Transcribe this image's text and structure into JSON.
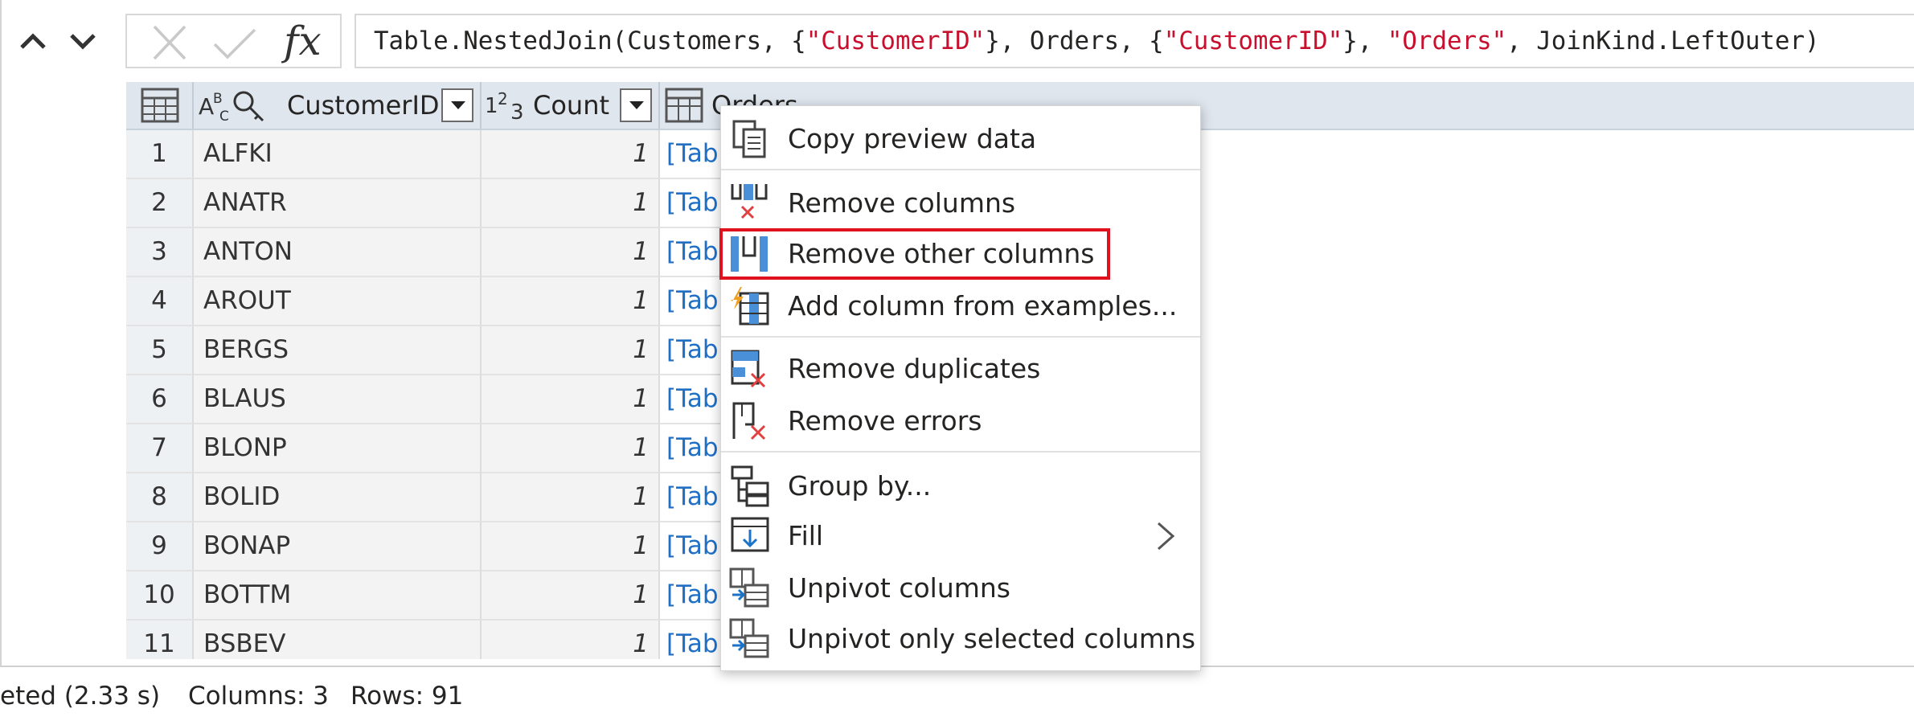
{
  "formula_bar": {
    "fx_label": "fx",
    "formula_parts": [
      {
        "text": "Table.NestedJoin(Customers, {",
        "kind": "plain"
      },
      {
        "text": "\"CustomerID\"",
        "kind": "string"
      },
      {
        "text": "}, Orders, {",
        "kind": "plain"
      },
      {
        "text": "\"CustomerID\"",
        "kind": "string"
      },
      {
        "text": "}, ",
        "kind": "plain"
      },
      {
        "text": "\"Orders\"",
        "kind": "string"
      },
      {
        "text": ", JoinKind.LeftOuter)",
        "kind": "plain"
      }
    ]
  },
  "grid": {
    "columns": [
      {
        "name": "CustomerID",
        "type_label": "ABC"
      },
      {
        "name": "Count",
        "type_label": "123"
      },
      {
        "name": "Orders",
        "type_label": "table"
      }
    ],
    "rows": [
      {
        "n": "1",
        "id": "ALFKI",
        "count": "1",
        "orders": "[Table]"
      },
      {
        "n": "2",
        "id": "ANATR",
        "count": "1",
        "orders": "[Table]"
      },
      {
        "n": "3",
        "id": "ANTON",
        "count": "1",
        "orders": "[Table]"
      },
      {
        "n": "4",
        "id": "AROUT",
        "count": "1",
        "orders": "[Table]"
      },
      {
        "n": "5",
        "id": "BERGS",
        "count": "1",
        "orders": "[Table]"
      },
      {
        "n": "6",
        "id": "BLAUS",
        "count": "1",
        "orders": "[Table]"
      },
      {
        "n": "7",
        "id": "BLONP",
        "count": "1",
        "orders": "[Table]"
      },
      {
        "n": "8",
        "id": "BOLID",
        "count": "1",
        "orders": "[Table]"
      },
      {
        "n": "9",
        "id": "BONAP",
        "count": "1",
        "orders": "[Table]"
      },
      {
        "n": "10",
        "id": "BOTTM",
        "count": "1",
        "orders": "[Table]"
      },
      {
        "n": "11",
        "id": "BSBEV",
        "count": "1",
        "orders": "[Table]"
      }
    ]
  },
  "context_menu": {
    "items": [
      {
        "label": "Copy preview data",
        "icon": "copy-icon"
      },
      {
        "label": "Remove columns",
        "icon": "remove-columns-icon"
      },
      {
        "label": "Remove other columns",
        "icon": "remove-other-columns-icon",
        "highlighted": true
      },
      {
        "label": "Add column from examples...",
        "icon": "add-column-examples-icon"
      },
      {
        "label": "Remove duplicates",
        "icon": "remove-duplicates-icon"
      },
      {
        "label": "Remove errors",
        "icon": "remove-errors-icon"
      },
      {
        "label": "Group by...",
        "icon": "group-by-icon"
      },
      {
        "label": "Fill",
        "icon": "fill-icon",
        "has_submenu": true
      },
      {
        "label": "Unpivot columns",
        "icon": "unpivot-columns-icon"
      },
      {
        "label": "Unpivot only selected columns",
        "icon": "unpivot-selected-columns-icon"
      }
    ]
  },
  "status_bar": {
    "completed": "eted (2.33 s)",
    "columns": "Columns: 3",
    "rows": "Rows: 91"
  },
  "colors": {
    "highlight_border": "#e0121f",
    "string_literal": "#c8102e",
    "link": "#1f6fc5",
    "header_bg": "#dfe6ee",
    "icon_blue": "#1a73c9"
  }
}
